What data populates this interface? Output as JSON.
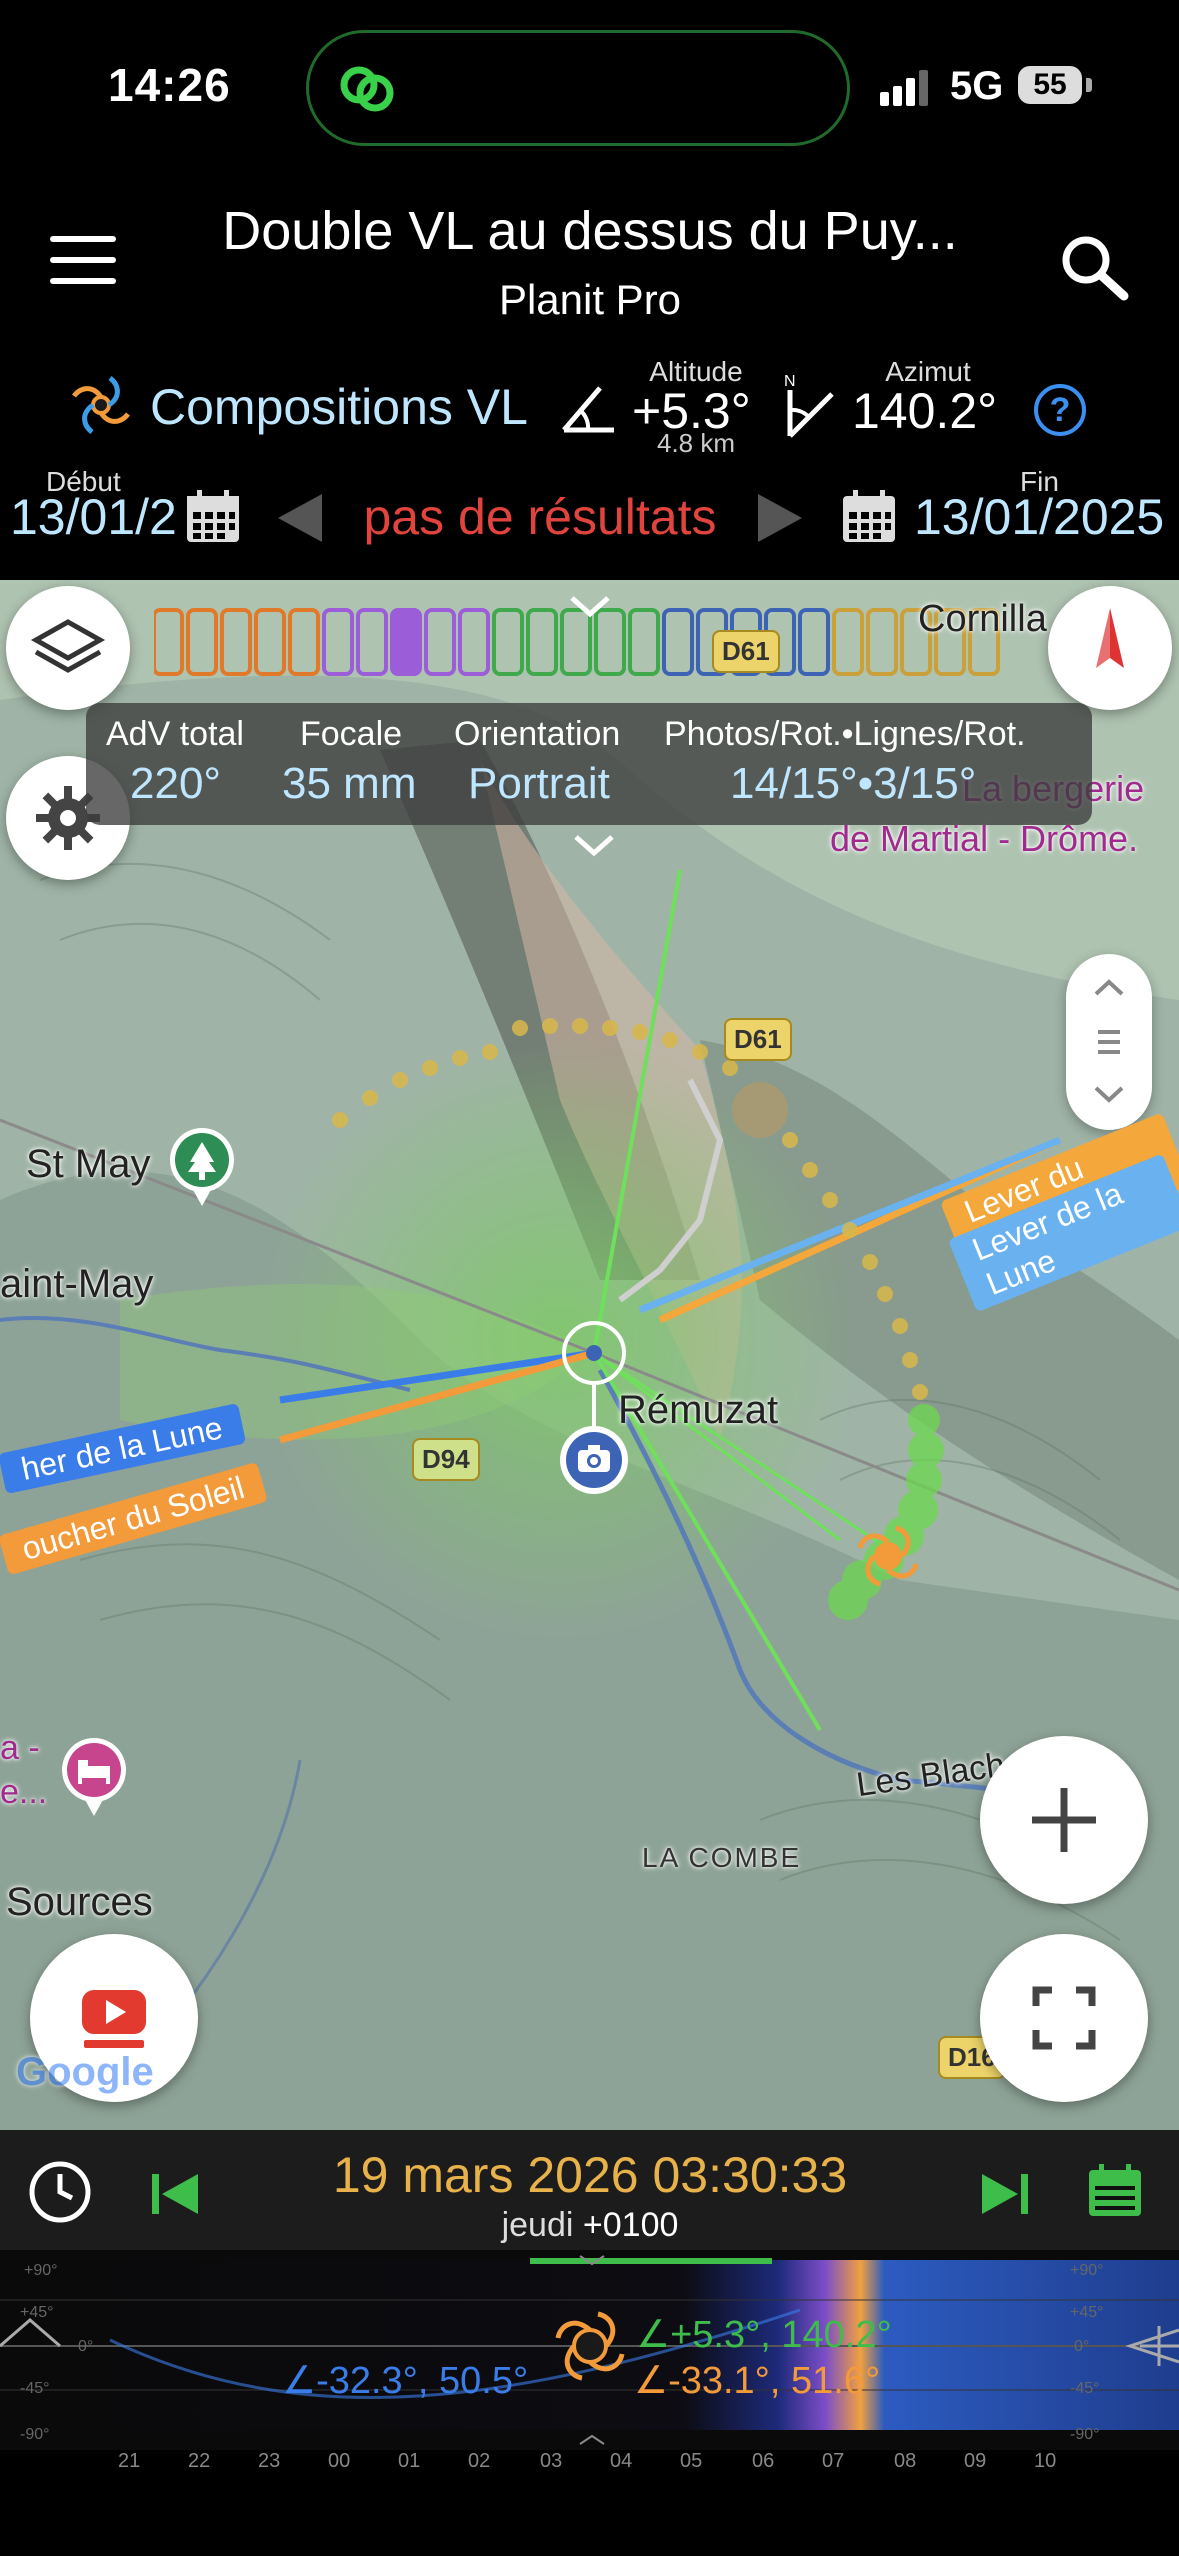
{
  "status_bar": {
    "time": "14:26",
    "network": "5G",
    "battery": "55"
  },
  "header": {
    "title": "Double VL au dessus du Puy...",
    "subtitle": "Planit Pro"
  },
  "composition": {
    "name": "Compositions VL",
    "altitude_caption": "Altitude",
    "altitude_value": "+5.3°",
    "altitude_distance": "4.8 km",
    "azimuth_caption": "Azimut",
    "azimuth_value": "140.2°",
    "help_label": "?"
  },
  "date_range": {
    "start_caption": "Début",
    "start_date": "13/01/2",
    "status": "pas de résultats",
    "end_caption": "Fin",
    "end_date": "13/01/2025"
  },
  "info_panel": {
    "fov_caption": "AdV total",
    "fov_value": "220°",
    "focal_caption": "Focale",
    "focal_value": "35 mm",
    "orientation_caption": "Orientation",
    "orientation_value": "Portrait",
    "photos_caption": "Photos/Rot.•Lignes/Rot.",
    "photos_value": "14/15°•3/15°"
  },
  "map": {
    "labels": {
      "cornillac": "Cornilla",
      "bergerie": "La bergerie",
      "martial": "de Martial - Drôme.",
      "stmay": "St May",
      "saint_may": "aint-May",
      "remuzat": "Rémuzat",
      "les_blach": "Les Blach",
      "la_combe": "LA COMBE",
      "sources": "Sources",
      "poi_pink": "a -\ne..."
    },
    "roads": {
      "d61_top": "D61",
      "d61": "D61",
      "d94": "D94",
      "d16": "D16"
    },
    "rays": {
      "moonrise": "Lever de la Lune",
      "sunrise": "Lever du Soleil",
      "moonset": "her de la Lune",
      "sunset": "oucher du Soleil"
    },
    "attribution": "Google"
  },
  "time_bar": {
    "date": "19 mars 2026",
    "time": "03:30:33",
    "weekday": "jeudi",
    "offset": "+0100"
  },
  "timeline": {
    "sun_readout": "∠+5.3°, 140.2°",
    "moon_readout": "∠-32.3°, 50.5°",
    "sun2_readout": "∠-33.1°, 51.6°",
    "hours": [
      "21",
      "22",
      "23",
      "00",
      "01",
      "02",
      "03",
      "04",
      "05",
      "06",
      "07",
      "08",
      "09",
      "10"
    ],
    "alt_marks": [
      "+90°",
      "+45°",
      "0°",
      "-45°",
      "-90°"
    ]
  },
  "colors": {
    "accent_blue": "#3a8ff0",
    "error_red": "#e0443d",
    "sun_orange": "#f39a3a",
    "moon_blue": "#3b7de8",
    "green": "#3fbd4b",
    "time_gold": "#e8b24a"
  }
}
